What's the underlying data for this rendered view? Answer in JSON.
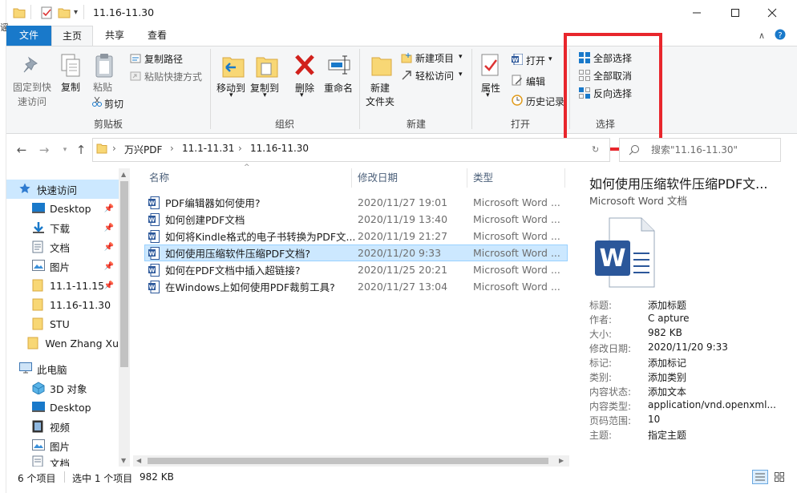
{
  "window": {
    "title": "11.16-11.30",
    "left_char": "谣"
  },
  "tabs": {
    "file": "文件",
    "home": "主页",
    "share": "共享",
    "view": "查看"
  },
  "ribbon": {
    "clipboard": {
      "pin_quick_l1": "固定到快",
      "pin_quick_l2": "速访问",
      "copy": "复制",
      "paste": "粘贴",
      "copy_path": "复制路径",
      "paste_shortcut": "粘贴快捷方式",
      "cut": "剪切",
      "group": "剪贴板"
    },
    "organize": {
      "move_to": "移动到",
      "copy_to": "复制到",
      "delete": "删除",
      "rename": "重命名",
      "group": "组织"
    },
    "new": {
      "new_folder_l1": "新建",
      "new_folder_l2": "文件夹",
      "new_item": "新建项目",
      "easy_access": "轻松访问",
      "group": "新建"
    },
    "open": {
      "properties": "属性",
      "open": "打开",
      "edit": "编辑",
      "history": "历史记录",
      "group": "打开"
    },
    "select": {
      "select_all": "全部选择",
      "select_none": "全部取消",
      "invert": "反向选择",
      "group": "选择"
    }
  },
  "address": {
    "crumbs": [
      "万兴PDF",
      "11.1-11.31",
      "11.16-11.30"
    ],
    "search_placeholder": "搜索\"11.16-11.30\""
  },
  "nav": {
    "quick_access": "快速访问",
    "items": [
      "Desktop",
      "下载",
      "文档",
      "图片",
      "11.1-11.15",
      "11.16-11.30",
      "STU",
      "Wen Zhang Xu"
    ],
    "this_pc": "此电脑",
    "pc_items": [
      "3D 对象",
      "Desktop",
      "视频",
      "图片",
      "文档"
    ]
  },
  "columns": {
    "name": "名称",
    "date": "修改日期",
    "type": "类型"
  },
  "files": [
    {
      "name": "PDF编辑器如何使用?",
      "date": "2020/11/27 19:01",
      "type": "Microsoft Word ..."
    },
    {
      "name": "如何创建PDF文档",
      "date": "2020/11/19 13:40",
      "type": "Microsoft Word ..."
    },
    {
      "name": "如何将Kindle格式的电子书转换为PDF文...",
      "date": "2020/11/19 21:27",
      "type": "Microsoft Word ..."
    },
    {
      "name": "如何使用压缩软件压缩PDF文档?",
      "date": "2020/11/20 9:33",
      "type": "Microsoft Word ..."
    },
    {
      "name": "如何在PDF文档中插入超链接?",
      "date": "2020/11/25 20:21",
      "type": "Microsoft Word ..."
    },
    {
      "name": "在Windows上如何使用PDF裁剪工具?",
      "date": "2020/11/27 13:04",
      "type": "Microsoft Word ..."
    }
  ],
  "preview": {
    "title": "如何使用压缩软件压缩PDF文...",
    "subtitle": "Microsoft Word 文档",
    "props": [
      {
        "k": "标题:",
        "v": "添加标题"
      },
      {
        "k": "作者:",
        "v": "C apture"
      },
      {
        "k": "大小:",
        "v": "982 KB"
      },
      {
        "k": "修改日期:",
        "v": "2020/11/20 9:33"
      },
      {
        "k": "标记:",
        "v": "添加标记"
      },
      {
        "k": "类别:",
        "v": "添加类别"
      },
      {
        "k": "内容状态:",
        "v": "添加文本"
      },
      {
        "k": "内容类型:",
        "v": "application/vnd.openxml..."
      },
      {
        "k": "页码范围:",
        "v": "10"
      },
      {
        "k": "主题:",
        "v": "指定主题"
      }
    ]
  },
  "status": {
    "count": "6 个项目",
    "selected": "选中 1 个项目",
    "size": "982 KB"
  },
  "colors": {
    "accent": "#1979ca",
    "selection": "#cce8ff",
    "highlight_box": "#e8262c"
  }
}
